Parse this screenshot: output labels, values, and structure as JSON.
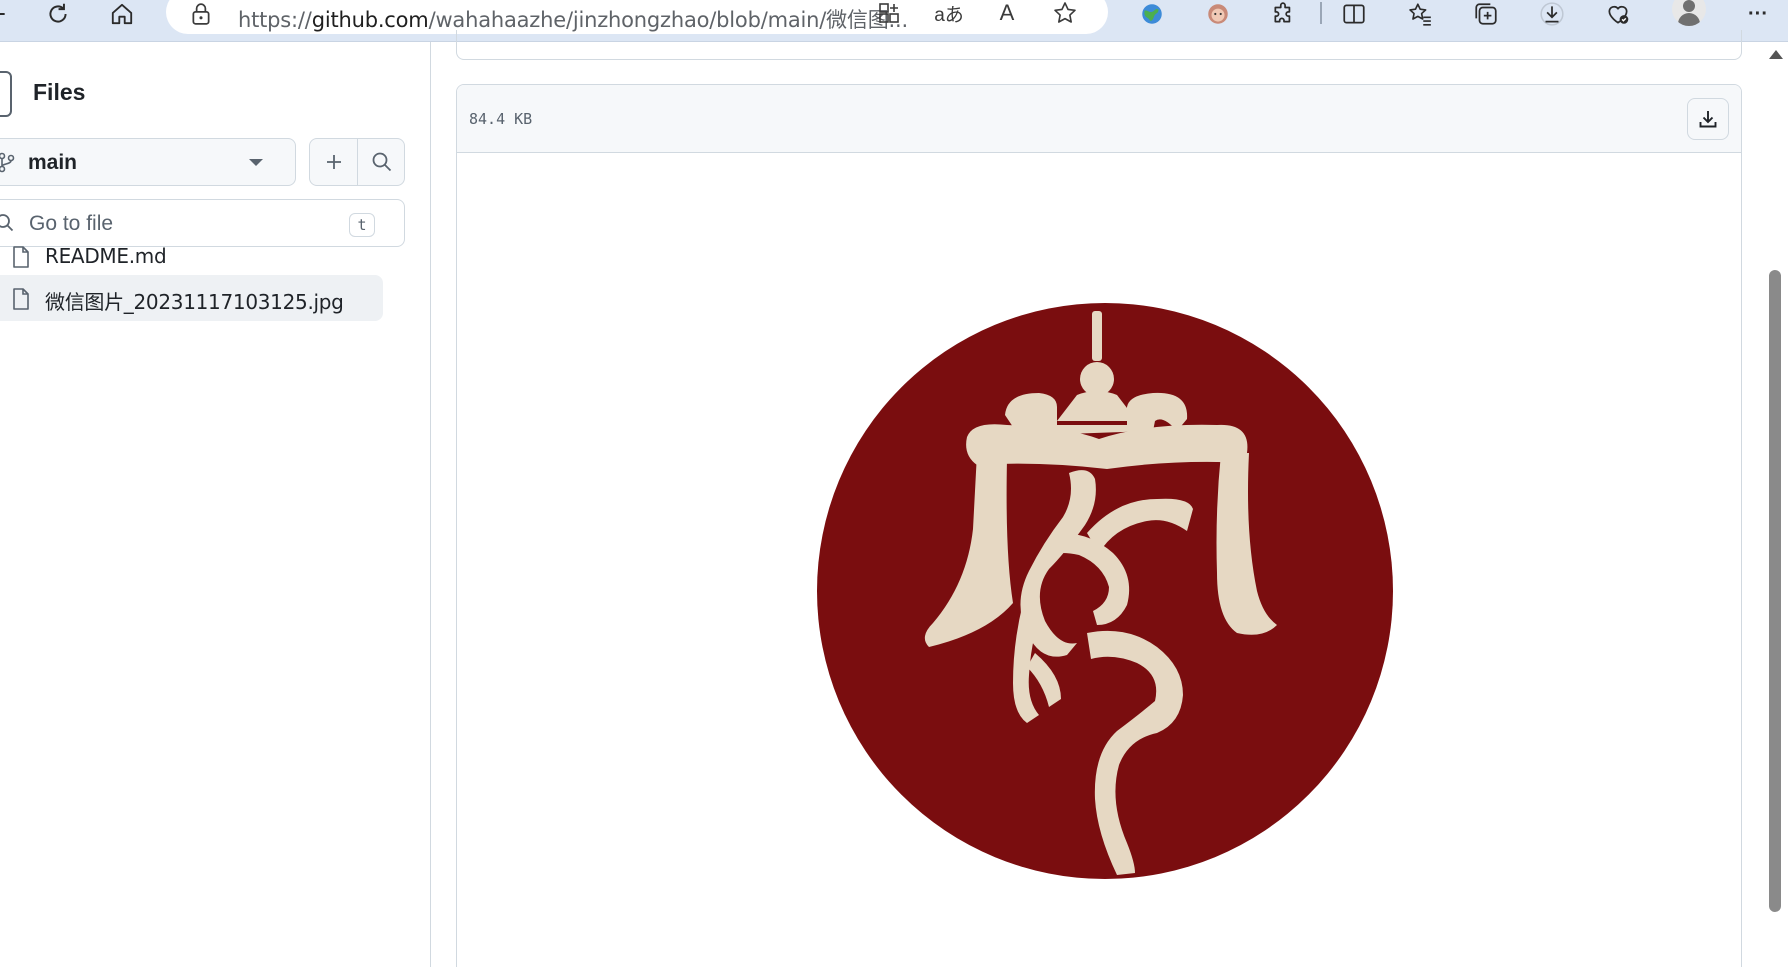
{
  "browser": {
    "url_prefix": "https://",
    "url_host": "github.com",
    "url_path": "/wahahaazhe/jinzhongzhao/blob/main/微信图...",
    "icons": [
      "refresh-icon",
      "home-icon",
      "lock-icon",
      "app-grid-icon",
      "translate-icon",
      "read-aloud-icon",
      "favorite-star-icon",
      "extension-globe-icon",
      "extension-monkey-icon",
      "extensions-puzzle-icon",
      "split-screen-icon",
      "favorites-icon",
      "collections-icon",
      "downloads-icon",
      "browser-essentials-icon",
      "profile-avatar-icon",
      "more-menu-icon"
    ],
    "translate_glyph": "aあ",
    "read_aloud_glyph": "A",
    "more_glyph": "···"
  },
  "sidebar": {
    "title": "Files",
    "branch": "main",
    "search_placeholder": "Go to file",
    "search_shortcut": "t",
    "files": [
      {
        "name": "README.md",
        "selected": false
      },
      {
        "name": "微信图片_20231117103125.jpg",
        "selected": true
      }
    ]
  },
  "file_view": {
    "size": "84.4 KB"
  },
  "image": {
    "description_icon": "seal-logo-image",
    "circle_color": "#7a0d0f",
    "glyph_color": "#e6d8c3"
  },
  "colors": {
    "toolbar_bg": "#dce6f4",
    "border": "#d1d9e0",
    "header_bg": "#f6f8fa",
    "muted_text": "#59636e"
  }
}
